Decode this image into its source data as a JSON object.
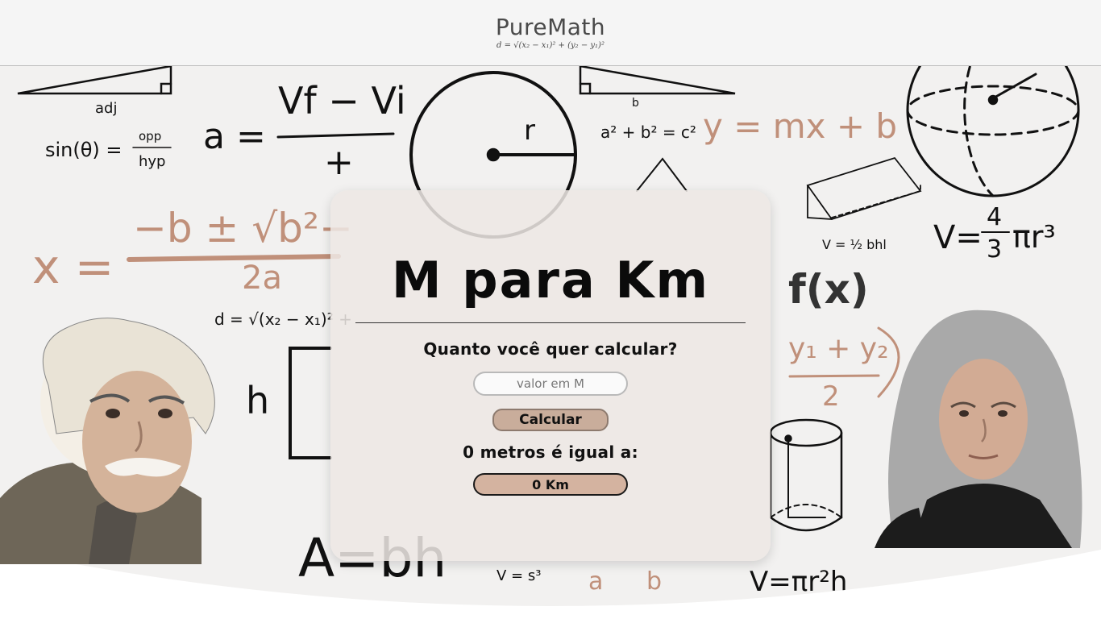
{
  "header": {
    "logo": "PureMath",
    "logo_formula": "d = √(x₂ − x₁)² + (y₂ − y₁)²"
  },
  "converter": {
    "title": "M para Km",
    "question": "Quanto você quer calcular?",
    "input_placeholder": "valor em M",
    "input_value": "",
    "button_label": "Calcular",
    "result_label": "0 metros é igual a:",
    "result_value": "0 Km"
  },
  "background": {
    "sin_formula": "sin(θ) =",
    "opp": "opp",
    "hyp": "hyp",
    "adj": "adj",
    "accel_a": "a =",
    "accel_num": "Vf − Vi",
    "accel_den": "+",
    "radius": "r",
    "pythag": "a² + b² = c²",
    "b_label": "b",
    "line_eq": "y = mx + b",
    "quadratic_x": "x =",
    "quadratic_num": "−b ± √b²−",
    "quadratic_den": "2a",
    "prism_volume": "V = ½ bhl",
    "sphere_volume_lhs": "V=",
    "sphere_volume_rhs": "πr³",
    "sphere_frac_num": "4",
    "sphere_frac_den": "3",
    "function": "f(x)",
    "distance": "d = √(x₂ − x₁)² +",
    "midpoint_num": "y₁ + y₂",
    "midpoint_den": "2",
    "h_label": "h",
    "area_partial": "A=bh",
    "cube_volume": "V = s³",
    "cylinder_volume": "V=πr²h",
    "frac_a": "a",
    "frac_b": "b"
  }
}
